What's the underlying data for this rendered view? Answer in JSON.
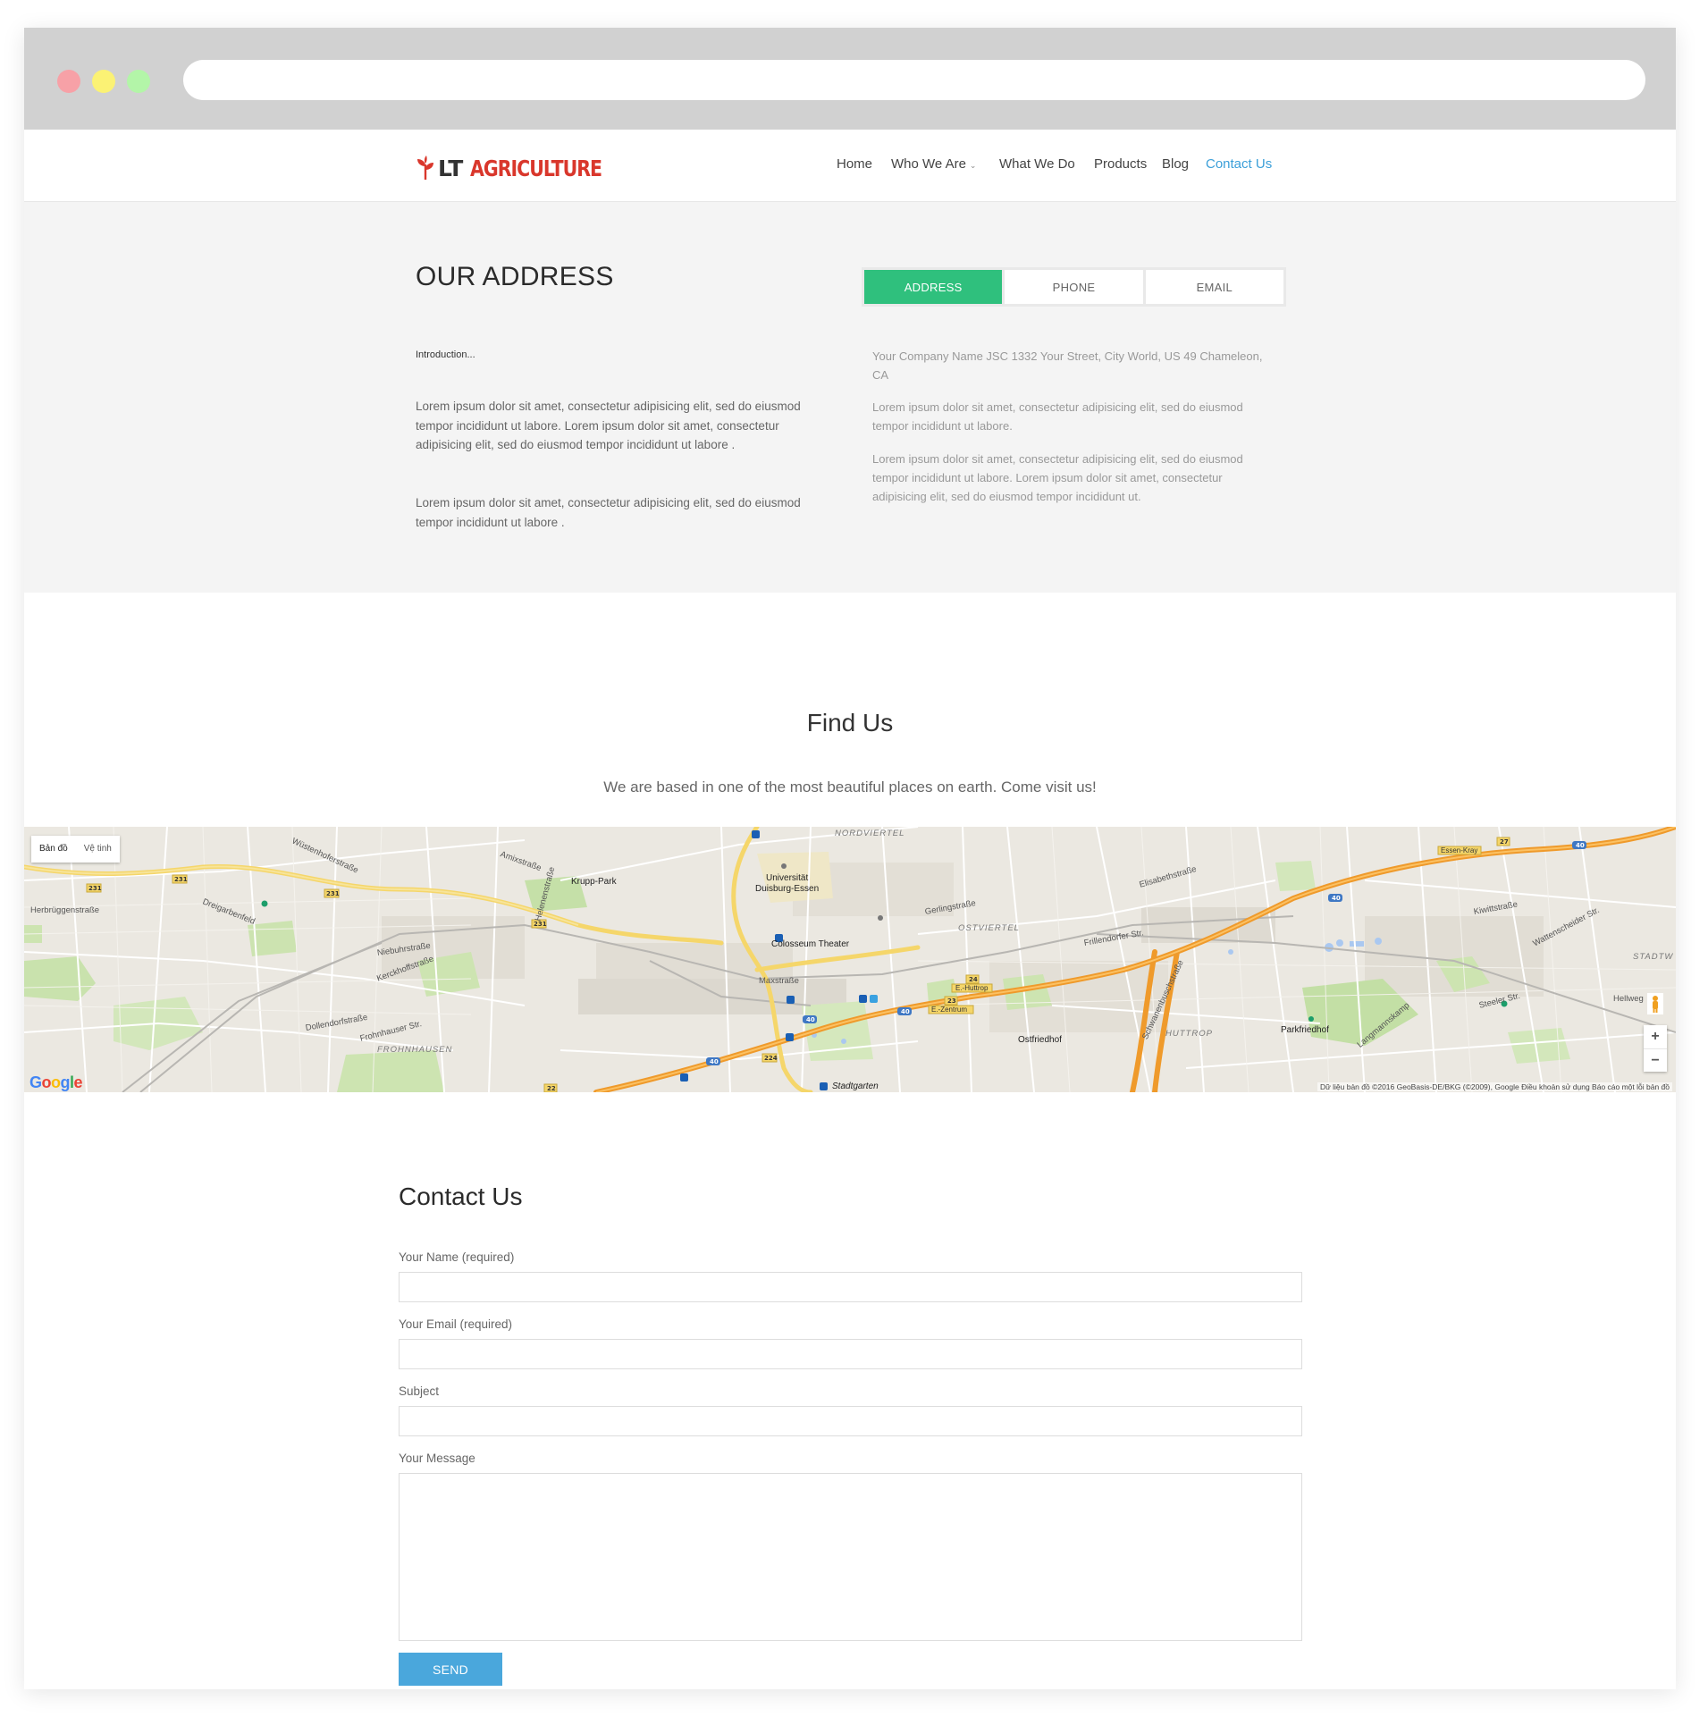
{
  "header": {
    "logo_lt": "LT",
    "logo_agriculture": "AGRICULTURE",
    "nav": [
      "Home",
      "Who We Are",
      "What We Do",
      "Products",
      "Blog",
      "Contact Us"
    ],
    "active_nav": "Contact Us"
  },
  "address": {
    "title": "OUR ADDRESS",
    "intro": "Introduction...",
    "left_paragraphs": [
      "Lorem ipsum dolor sit amet, consectetur adipisicing elit, sed do eiusmod tempor incididunt ut labore. Lorem ipsum dolor sit amet, consectetur adipisicing elit, sed do eiusmod tempor incididunt ut labore .",
      "Lorem ipsum dolor sit amet, consectetur adipisicing elit, sed do eiusmod tempor incididunt ut labore ."
    ],
    "tabs": [
      "ADDRESS",
      "PHONE",
      "EMAIL"
    ],
    "active_tab": "ADDRESS",
    "right_paragraphs": [
      "Your Company Name JSC 1332 Your Street, City World, US 49 Chameleon, CA",
      "Lorem ipsum dolor sit amet, consectetur adipisicing elit, sed do eiusmod tempor incididunt ut labore.",
      "Lorem ipsum dolor sit amet, consectetur adipisicing elit, sed do eiusmod tempor incididunt ut labore. Lorem ipsum dolor sit amet, consectetur adipisicing elit, sed do eiusmod tempor incididunt ut."
    ]
  },
  "find_us": {
    "title": "Find Us",
    "subtitle": "We are based in one of the most beautiful places on earth. Come visit us!"
  },
  "map": {
    "map_type_map": "Bản đồ",
    "map_type_satellite": "Vệ tinh",
    "zoom_in": "+",
    "zoom_out": "−",
    "google": "Google",
    "attribution": "Dữ liệu bản đồ ©2016 GeoBasis-DE/BKG (©2009), Google    Điều khoản sử dụng    Báo cáo một lỗi bản đồ",
    "labels": {
      "nordviertel": "NORDVIERTEL",
      "uni": "Universität",
      "uni2": "Duisburg-Essen",
      "krupp": "Krupp-Park",
      "colosseum": "Colosseum Theater",
      "ostviertel": "OSTVIERTEL",
      "frohnhausen": "FROHNHAUSEN",
      "huttrop": "HUTTROP",
      "parkfriedhof": "Parkfriedhof",
      "ostfriedhof": "Ostfriedhof",
      "stadtgarten": "Stadtgarten",
      "herbruggen": "Herbrüggenstraße",
      "niebuhr": "Niebuhrstraße",
      "kerckhoff": "Kerckhoffstraße",
      "dollendorf": "Dollendorfstraße",
      "frohnhauser": "Frohnhauser Str.",
      "maxstrasse": "Maxstraße",
      "gerling": "Gerlingstraße",
      "frillendorfer": "Frillendorfer Str.",
      "elisabeth": "Elisabethstraße",
      "kiwitt": "Kiwittstraße",
      "wattenscheider": "Wattenscheider Str.",
      "steeler": "Steeler Str.",
      "essenkray": "Essen-Kray",
      "huttrop_exit": "E.-Huttrop",
      "zentrum_exit": "E.-Zentrum",
      "stadtw": "STADTW",
      "hellweg": "Hellweg",
      "dreigarben": "Dreigarbenfeld",
      "amix": "Amixstraße",
      "helenen": "Helenenstraße",
      "wusten": "Wüstenhofer­straße",
      "langmann": "Langmannskamp",
      "schwanen": "Schwanenbuschstraße"
    }
  },
  "contact": {
    "title": "Contact Us",
    "fields": [
      "Your Name (required)",
      "Your Email (required)",
      "Subject",
      "Your Message"
    ],
    "send": "SEND"
  },
  "colors": {
    "accent_green": "#2fc07d",
    "accent_blue": "#4aa7dc",
    "nav_active": "#3b9fd9",
    "logo_red": "#d9372c"
  }
}
